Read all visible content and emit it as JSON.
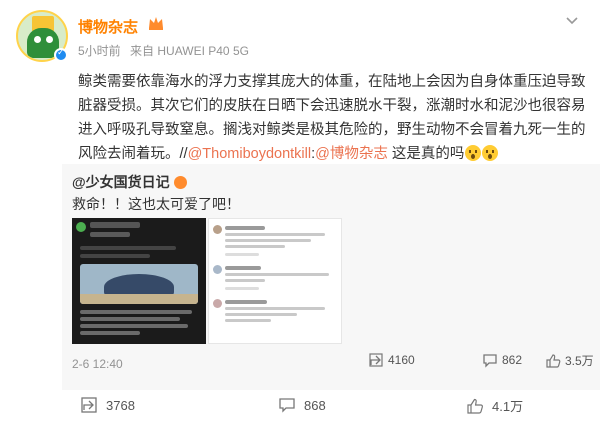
{
  "post": {
    "author": "博物杂志",
    "time": "5小时前",
    "source": "来自 HUAWEI P40 5G",
    "text_part1": "鲸类需要依靠海水的浮力支撑其庞大的体重，在陆地上会因为自身体重压迫导致脏器受损。其次它们的皮肤在日晒下会迅速脱水干裂，涨潮时水和泥沙也很容易进入呼吸孔导致窒息。搁浅对鲸类是极其危险的，野生动物不会冒着九死一生的风险去闹着玩。//",
    "mention1": "@Thomiboydontkill",
    "colon": ":",
    "mention2": "@博物杂志",
    "text_part2": " 这是真的吗"
  },
  "repost": {
    "author": "@少女国货日记",
    "text": "救命！！这也太可爱了吧！",
    "time": "2-6 12:40",
    "shares": "4160",
    "comments": "862",
    "likes": "3.5万"
  },
  "actions": {
    "shares": "3768",
    "comments": "868",
    "likes": "4.1万"
  },
  "colors": {
    "author_name": "#ff8200",
    "link": "#eb7350",
    "repost_bg": "#f7f7f7",
    "meta": "#939393"
  },
  "icons": [
    "crown-icon",
    "more-icon",
    "verified-icon",
    "share-icon",
    "comment-icon",
    "like-icon"
  ]
}
